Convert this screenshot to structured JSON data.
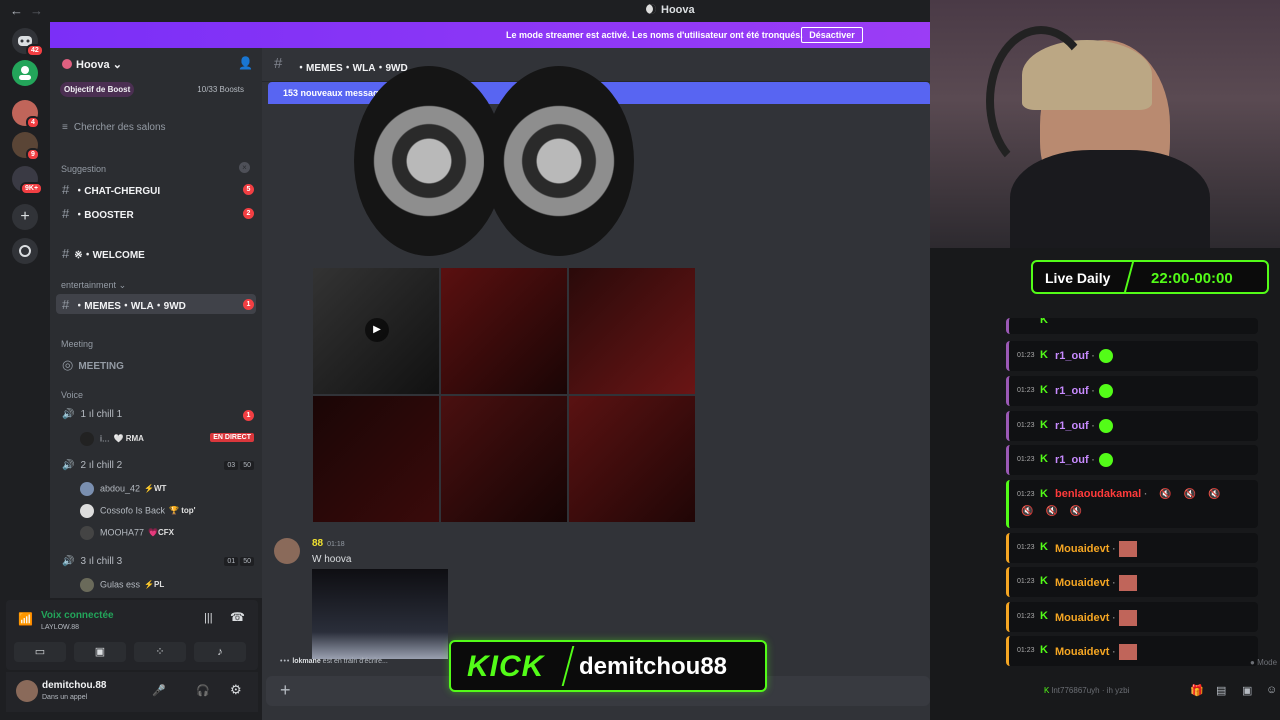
{
  "window": {
    "title": "Hoova",
    "back_icon": "←",
    "forward_icon": "→"
  },
  "rail": {
    "home_badge": "42",
    "friends_badge": "",
    "servers": [
      {
        "badge": "4"
      },
      {
        "badge": "9"
      },
      {
        "badge": "9K+"
      }
    ]
  },
  "streamer_banner": {
    "message": "Le mode streamer est activé. Les noms d'utilisateur ont été tronqués.",
    "button": "Désactiver"
  },
  "sidebar": {
    "server_name": "Hoova",
    "boost_goal": "Objectif de Boost",
    "boost_count": "10/33 Boosts",
    "search": "Chercher des salons",
    "categories": {
      "suggestion": "Suggestion",
      "entertainment": "entertainment",
      "meeting": "Meeting",
      "voice": "Voice"
    },
    "channels": [
      {
        "name": "・CHAT-CHERGUI",
        "count": "5"
      },
      {
        "name": "・BOOSTER",
        "count": "2"
      },
      {
        "name": "※・WELCOME",
        "count": ""
      },
      {
        "name": "・MEMES・WLA・9WD",
        "count": "1"
      },
      {
        "name": "MEETING",
        "count": ""
      }
    ],
    "voice_channels": [
      {
        "name": "1 ıl chill 1",
        "count": "1"
      },
      {
        "name": "2 ıl chill 2",
        "slots_a": "03",
        "slots_b": "50"
      },
      {
        "name": "3 ıl chill 3",
        "slots_a": "01",
        "slots_b": "50"
      }
    ],
    "voice_users": [
      {
        "name": "i...",
        "tag": "🤍 RMA",
        "live": "EN DIRECT"
      },
      {
        "name": "abdou_42",
        "tag": "⚡WT"
      },
      {
        "name": "Cossofo Is Back",
        "tag": "🏆 top'"
      },
      {
        "name": "MOOHA77",
        "tag": "💗CFX"
      },
      {
        "name": "Gulas ess",
        "tag": "⚡PL"
      }
    ]
  },
  "voice_panel": {
    "status": "Voix connectée",
    "channel": "LAYLOW.88"
  },
  "user_bar": {
    "username": "demitchou.88",
    "status": "Dans un appel"
  },
  "chat": {
    "channel_name": "・MEMES・WLA・9WD",
    "new_messages": "153 nouveaux messages depuis 01:01",
    "message": {
      "author": "88",
      "time": "01:18",
      "text": "W hoova"
    },
    "typing_user": "lokmane",
    "typing_text": "est en train d'écrire..."
  },
  "overlay": {
    "live_daily_label": "Live Daily",
    "live_daily_time": "22:00-00:00",
    "chat": [
      {
        "time": "01:23",
        "user": "r1_ouf",
        "color": "#c88bff",
        "emote": "green"
      },
      {
        "time": "01:23",
        "user": "r1_ouf",
        "color": "#c88bff",
        "emote": "green"
      },
      {
        "time": "01:23",
        "user": "r1_ouf",
        "color": "#c88bff",
        "emote": "green"
      },
      {
        "time": "01:23",
        "user": "r1_ouf",
        "color": "#c88bff",
        "emote": "green"
      },
      {
        "time": "01:23",
        "user": "benlaoudakamal",
        "color": "#ff3b3b",
        "emote": "mute"
      },
      {
        "time": "01:23",
        "user": "Mouaidevt",
        "color": "#f5a623",
        "emote": "face"
      },
      {
        "time": "01:23",
        "user": "Mouaidevt",
        "color": "#f5a623",
        "emote": "face"
      },
      {
        "time": "01:23",
        "user": "Mouaidevt",
        "color": "#f5a623",
        "emote": "face"
      },
      {
        "time": "01:23",
        "user": "Mouaidevt",
        "color": "#f5a623",
        "emote": "face"
      }
    ],
    "chat_colors": {
      "accent": "#53fc18",
      "row_border": "#9b59b6"
    },
    "bottom_text": "lnt776867uyh",
    "bottom_text2": "ih yzbi",
    "mode_label": "Mode"
  },
  "kick": {
    "logo": "KICK",
    "channel": "demitchou88"
  }
}
